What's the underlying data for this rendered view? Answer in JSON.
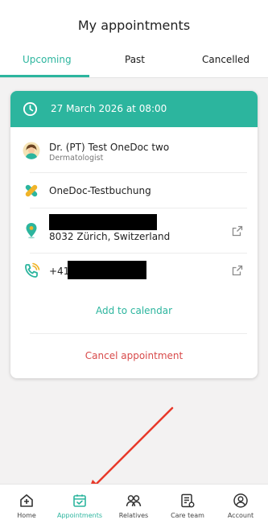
{
  "header": {
    "title": "My appointments",
    "tabs": [
      {
        "label": "Upcoming",
        "active": true
      },
      {
        "label": "Past",
        "active": false
      },
      {
        "label": "Cancelled",
        "active": false
      }
    ]
  },
  "appointment": {
    "datetime": "27 March 2026 at 08:00",
    "doctor_name": "Dr. (PT) Test OneDoc two",
    "specialty": "Dermatologist",
    "service": "OneDoc-Testbuchung",
    "address_line": "8032 Zürich, Switzerland",
    "phone_prefix": "+41",
    "add_to_calendar_label": "Add to calendar",
    "cancel_label": "Cancel appointment"
  },
  "nav": {
    "items": [
      {
        "label": "Home",
        "icon": "home-icon",
        "active": false
      },
      {
        "label": "Appointments",
        "icon": "calendar-check-icon",
        "active": true
      },
      {
        "label": "Relatives",
        "icon": "relatives-icon",
        "active": false
      },
      {
        "label": "Care team",
        "icon": "care-team-icon",
        "active": false
      },
      {
        "label": "Account",
        "icon": "account-icon",
        "active": false
      }
    ]
  },
  "colors": {
    "accent": "#2cb59e",
    "danger": "#d84a4a",
    "annotation_arrow": "#e8392a"
  }
}
